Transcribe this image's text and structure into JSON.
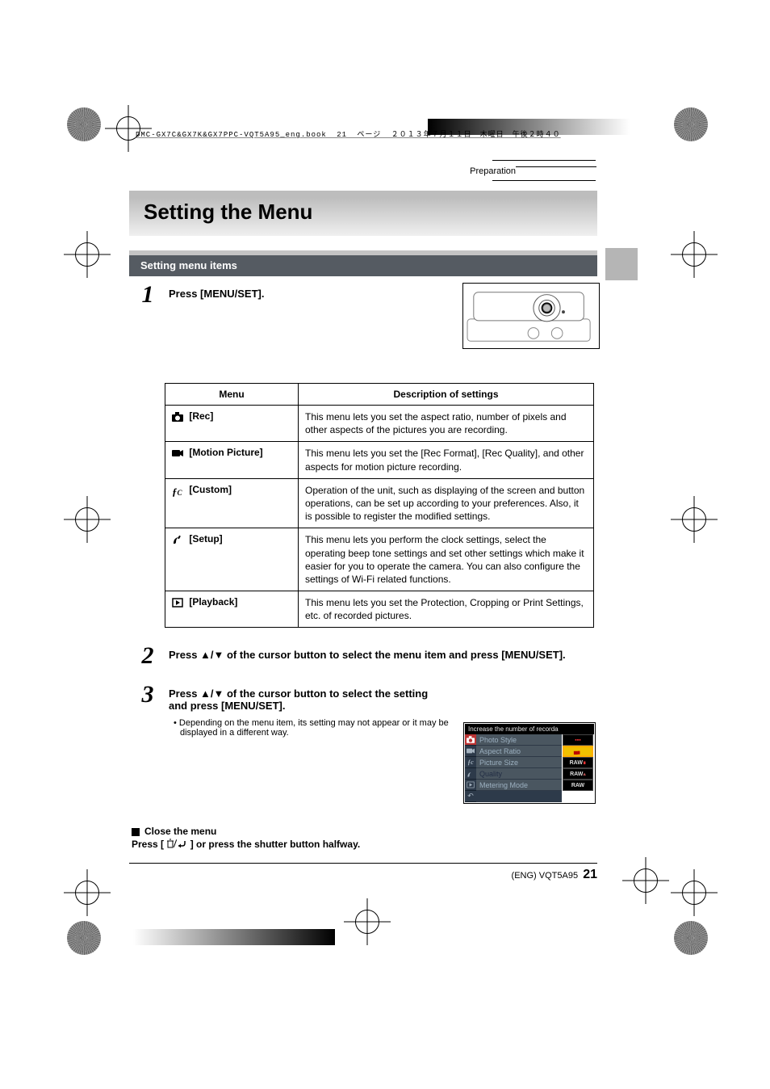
{
  "header_file": "DMC-GX7C&GX7K&GX7PPC-VQT5A95_eng.book  21 ページ  ２０１３年７月１１日　木曜日　午後２時４０",
  "crumb": "Preparation",
  "title": "Setting the Menu",
  "subheading": "Setting menu items",
  "steps": {
    "s1": {
      "num": "1",
      "heading": "Press [MENU/SET]."
    },
    "s2": {
      "num": "2",
      "heading": "Press ▲/▼ of the cursor button to select the menu item and press [MENU/SET]."
    },
    "s3": {
      "num": "3",
      "heading": "Press ▲/▼ of the cursor button to select the setting and press [MENU/SET].",
      "bullet": "• Depending on the menu item, its setting may not appear or it may be displayed in a different way."
    }
  },
  "table": {
    "head": {
      "menu": "Menu",
      "desc": "Description of settings"
    },
    "rows": [
      {
        "name": "[Rec]",
        "desc": "This menu lets you set the aspect ratio, number of pixels and other aspects of the pictures you are recording."
      },
      {
        "name": "[Motion Picture]",
        "desc": "This menu lets you set the [Rec Format], [Rec Quality], and other aspects for motion picture recording."
      },
      {
        "name": "[Custom]",
        "desc": "Operation of the unit, such as displaying of the screen and button operations, can be set up according to your preferences. Also, it is possible to register the modified settings."
      },
      {
        "name": "[Setup]",
        "desc": "This menu lets you perform the clock settings, select the operating beep tone settings and set other settings which make it easier for you to operate the camera. You can also configure the settings of Wi-Fi related functions."
      },
      {
        "name": "[Playback]",
        "desc": "This menu lets you set the Protection, Cropping or Print Settings, etc. of recorded pictures."
      }
    ]
  },
  "menu_fig": {
    "header": "Increase the number of recorda",
    "rows": [
      {
        "label": "Photo Style",
        "size": ""
      },
      {
        "label": "Aspect Ratio",
        "size": ""
      },
      {
        "label": "Picture Size",
        "size": "RAW"
      },
      {
        "label": "Quality",
        "size": "RAW"
      },
      {
        "label": "Metering Mode",
        "size": "RAW"
      }
    ]
  },
  "close": {
    "heading": "Close the menu",
    "line2_a": "Press [",
    "line2_b": "] or press the shutter button halfway."
  },
  "footer": {
    "code": "(ENG) VQT5A95",
    "page": "21"
  }
}
